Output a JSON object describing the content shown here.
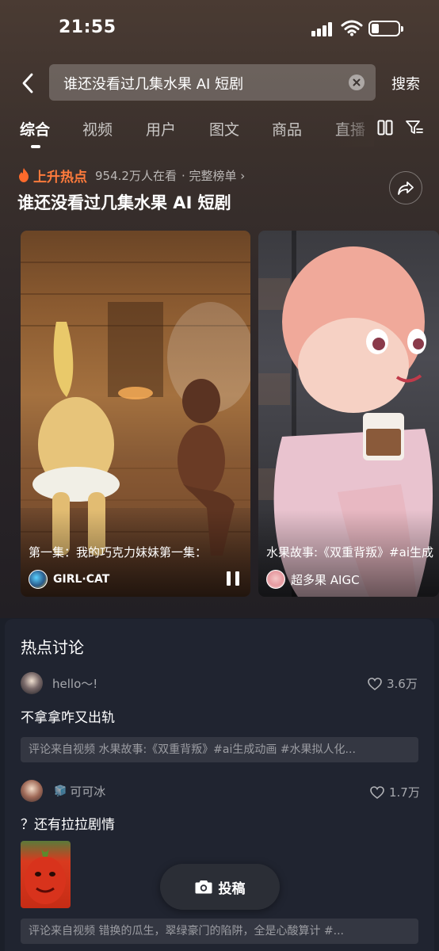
{
  "status_bar": {
    "time": "21:55"
  },
  "search": {
    "query": "谁还没看过几集水果 AI 短剧",
    "button_label": "搜索"
  },
  "tabs": [
    {
      "label": "综合",
      "active": true
    },
    {
      "label": "视频"
    },
    {
      "label": "用户"
    },
    {
      "label": "图文"
    },
    {
      "label": "商品"
    },
    {
      "label": "直播"
    }
  ],
  "hot_topic": {
    "label": "上升热点",
    "watching": "954.2万人在看",
    "full_list": "· 完整榜单 ›",
    "title": "谁还没看过几集水果 AI 短剧"
  },
  "videos": [
    {
      "title": "第一集：我的巧克力妹妹第一集：",
      "author": "GIRL·CAT",
      "playing": true
    },
    {
      "title": "水果故事:《双重背叛》#ai生成",
      "author": "超多果 AIGC"
    }
  ],
  "discussion": {
    "title": "热点讨论",
    "comments": [
      {
        "user": "hello～!",
        "likes": "3.6万",
        "text": "不拿拿咋又出轨",
        "source": "评论来自视频 水果故事:《双重背叛》#ai生成动画 #水果拟人化..."
      },
      {
        "user_badge": "🧊",
        "user": "可可冰",
        "likes": "1.7万",
        "text": "？还有拉拉剧情",
        "source": "评论来自视频 错换的瓜生，翠绿豪门的陷阱，全是心酸算计 #..."
      }
    ]
  },
  "post_button": {
    "label": "投稿"
  },
  "colors": {
    "hot_accent": "#ff7b3c",
    "panel_bg": "#202430"
  }
}
